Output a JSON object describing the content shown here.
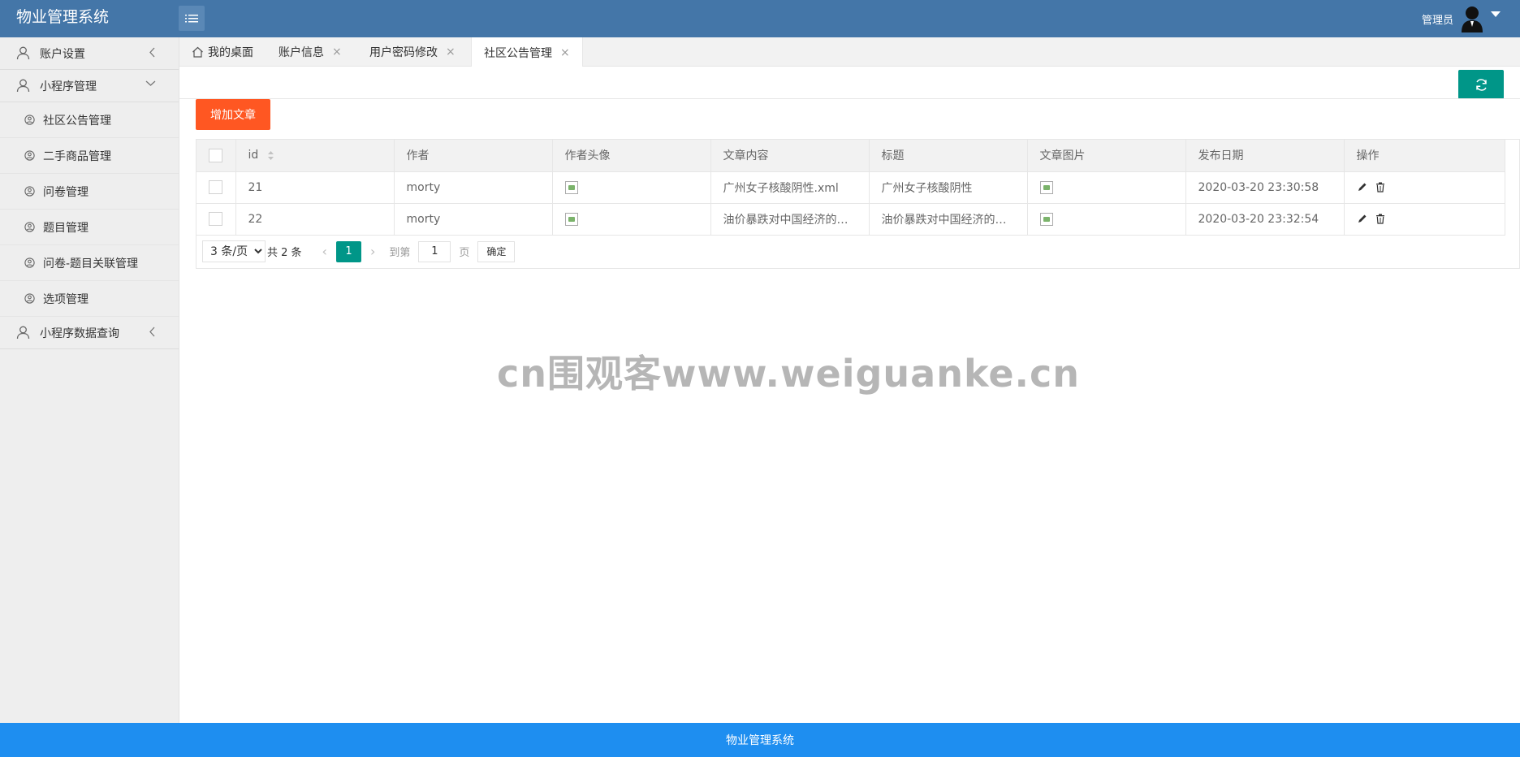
{
  "app": {
    "title": "物业管理系统",
    "user": "管理员"
  },
  "sidebar": {
    "items": [
      {
        "label": "账户设置",
        "icon": "user-icon",
        "expanded": false
      },
      {
        "label": "小程序管理",
        "icon": "user-icon",
        "expanded": true,
        "children": [
          "社区公告管理",
          "二手商品管理",
          "问卷管理",
          "题目管理",
          "问卷-题目关联管理",
          "选项管理"
        ]
      },
      {
        "label": "小程序数据查询",
        "icon": "user-icon",
        "expanded": false
      }
    ]
  },
  "tabs": [
    {
      "label": "我的桌面",
      "icon": "home-icon",
      "closable": false
    },
    {
      "label": "账户信息",
      "closable": true
    },
    {
      "label": "用户密码修改",
      "closable": true
    },
    {
      "label": "社区公告管理",
      "closable": true,
      "active": true
    }
  ],
  "close_glyph": "×",
  "toolbar": {
    "add_label": "增加文章"
  },
  "table": {
    "headers": [
      "id",
      "作者",
      "作者头像",
      "文章内容",
      "标题",
      "文章图片",
      "发布日期",
      "操作"
    ],
    "rows": [
      {
        "id": "21",
        "author": "morty",
        "content": "广州女子核酸阴性.xml",
        "title": "广州女子核酸阴性",
        "date": "2020-03-20 23:30:58"
      },
      {
        "id": "22",
        "author": "morty",
        "content": "油价暴跌对中国经济的影响",
        "title": "油价暴跌对中国经济的影响",
        "date": "2020-03-20 23:32:54"
      }
    ]
  },
  "pager": {
    "page_size": "3 条/页",
    "total": "共 2 条",
    "current": "1",
    "goto_label": "到第",
    "goto_value": "1",
    "page_unit": "页",
    "confirm": "确定"
  },
  "watermark": "cn围观客www.weiguanke.cn",
  "footer": {
    "text": "物业管理系统"
  },
  "colors": {
    "header": "#4476a8",
    "footer": "#1e8ef0",
    "primary": "#009688",
    "danger": "#ff5722"
  }
}
